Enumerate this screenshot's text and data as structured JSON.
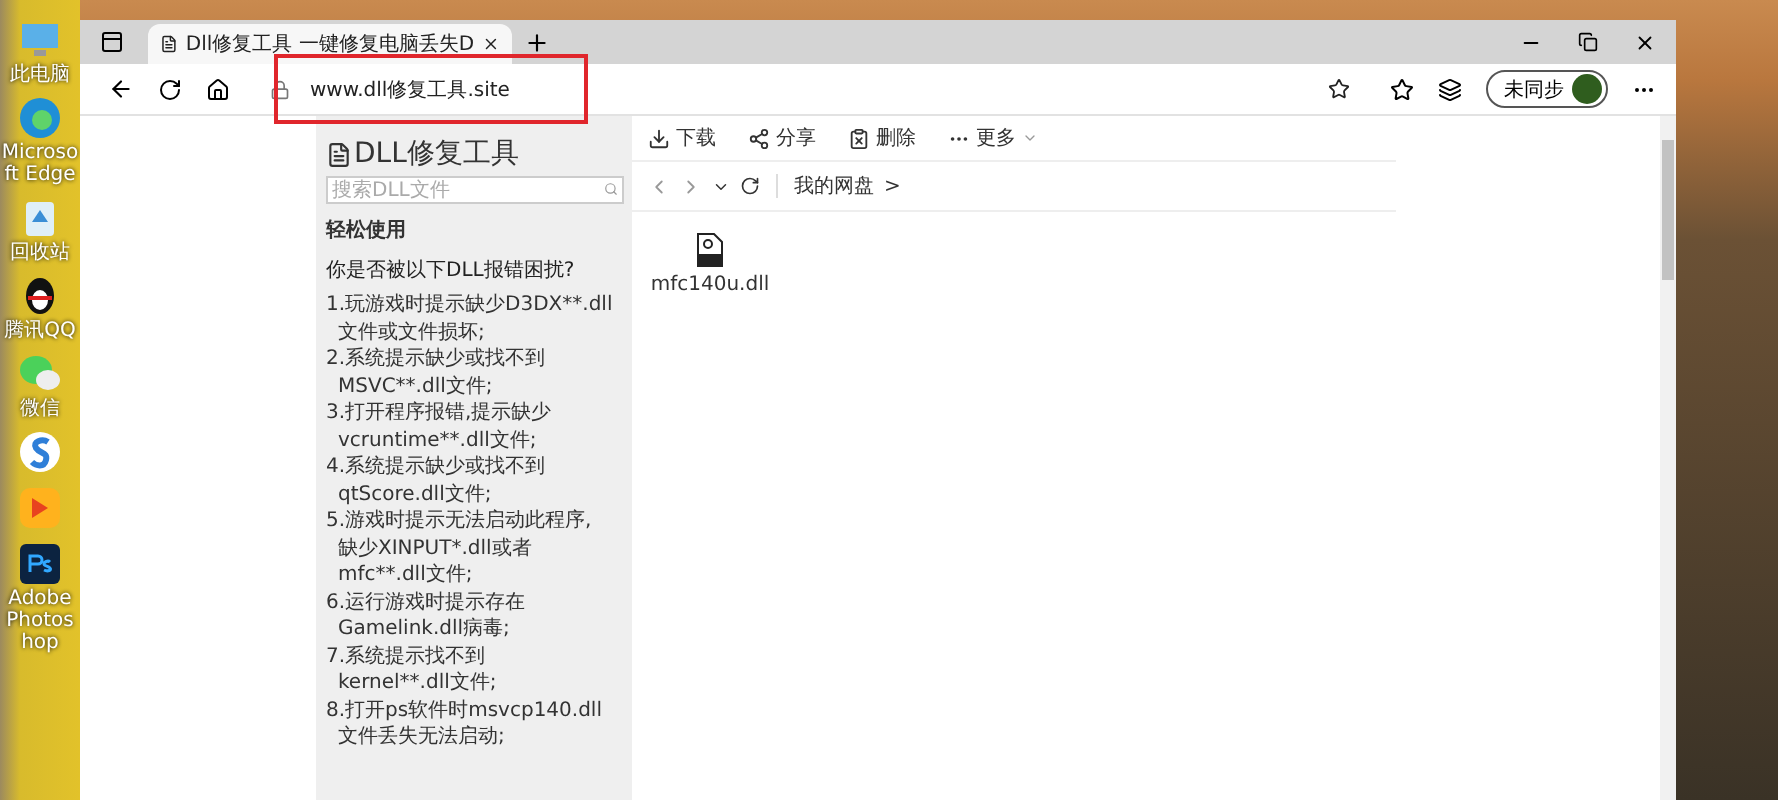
{
  "desktop_icons": [
    {
      "kind": "computer",
      "label": "此电脑"
    },
    {
      "kind": "edge",
      "label": "Microsoft Edge"
    },
    {
      "kind": "recycle",
      "label": "回收站"
    },
    {
      "kind": "qq",
      "label": "腾讯QQ"
    },
    {
      "kind": "wechat",
      "label": "微信"
    },
    {
      "kind": "sogou"
    },
    {
      "kind": "orange"
    },
    {
      "kind": "photoshop",
      "label": "Adobe Photoshop"
    }
  ],
  "browser": {
    "tab": {
      "title": "Dll修复工具 一键修复电脑丢失D",
      "selected": true
    },
    "address": "www.dll修复工具.site",
    "sync_button": "未同步"
  },
  "page": {
    "sidebar": {
      "title": "DLL修复工具",
      "search": {
        "placeholder": "搜索DLL文件"
      },
      "section": "轻松使用",
      "question": "你是否被以下DLL报错困扰?",
      "items": [
        {
          "lines": [
            "1.玩游戏时提示缺少D3DX**.dll",
            "文件或文件损坏;"
          ]
        },
        {
          "lines": [
            "2.系统提示缺少或找不到",
            "MSVC**.dll文件;"
          ]
        },
        {
          "lines": [
            "3.打开程序报错,提示缺少",
            "vcruntime**.dll文件;"
          ]
        },
        {
          "lines": [
            "4.系统提示缺少或找不到",
            "qtScore.dll文件;"
          ]
        },
        {
          "lines": [
            "5.游戏时提示无法启动此程序,",
            "缺少XINPUT*.dll或者",
            "mfc**.dll文件;"
          ]
        },
        {
          "lines": [
            "6.运行游戏时提示存在",
            "Gamelink.dll病毒;"
          ]
        },
        {
          "lines": [
            "7.系统提示找不到",
            "kernel**.dll文件;"
          ]
        },
        {
          "lines": [
            "8.打开ps软件时msvcp140.dll",
            "文件丢失无法启动;"
          ]
        }
      ]
    },
    "toolbar": [
      {
        "kind": "download",
        "label": "下载"
      },
      {
        "kind": "share",
        "label": "分享"
      },
      {
        "kind": "delete",
        "label": "删除"
      },
      {
        "kind": "more",
        "label": "更多"
      }
    ],
    "path": [
      "我的网盘",
      ">"
    ],
    "files": [
      {
        "name": "mfc140u.dll"
      }
    ]
  }
}
